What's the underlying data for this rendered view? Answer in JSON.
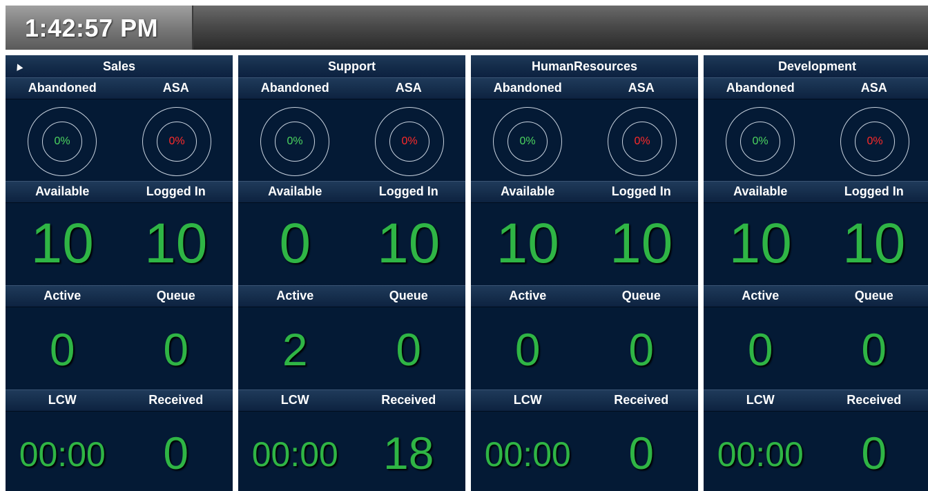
{
  "header": {
    "clock": "1:42:57 PM"
  },
  "colors": {
    "value_green": "#2fb545",
    "abandoned_pct": "#4cd45f",
    "asa_pct": "#ff2a2a",
    "panel_bg": "#041a35"
  },
  "labels": {
    "abandoned": "Abandoned",
    "asa": "ASA",
    "available": "Available",
    "logged_in": "Logged In",
    "active": "Active",
    "queue": "Queue",
    "lcw": "LCW",
    "received": "Received"
  },
  "panels": [
    {
      "title": "Sales",
      "abandoned_pct": "0%",
      "asa_pct": "0%",
      "available": "10",
      "logged_in": "10",
      "active": "0",
      "queue": "0",
      "lcw": "00:00",
      "received": "0"
    },
    {
      "title": "Support",
      "abandoned_pct": "0%",
      "asa_pct": "0%",
      "available": "0",
      "logged_in": "10",
      "active": "2",
      "queue": "0",
      "lcw": "00:00",
      "received": "18"
    },
    {
      "title": "HumanResources",
      "abandoned_pct": "0%",
      "asa_pct": "0%",
      "available": "10",
      "logged_in": "10",
      "active": "0",
      "queue": "0",
      "lcw": "00:00",
      "received": "0"
    },
    {
      "title": "Development",
      "abandoned_pct": "0%",
      "asa_pct": "0%",
      "available": "10",
      "logged_in": "10",
      "active": "0",
      "queue": "0",
      "lcw": "00:00",
      "received": "0"
    }
  ]
}
